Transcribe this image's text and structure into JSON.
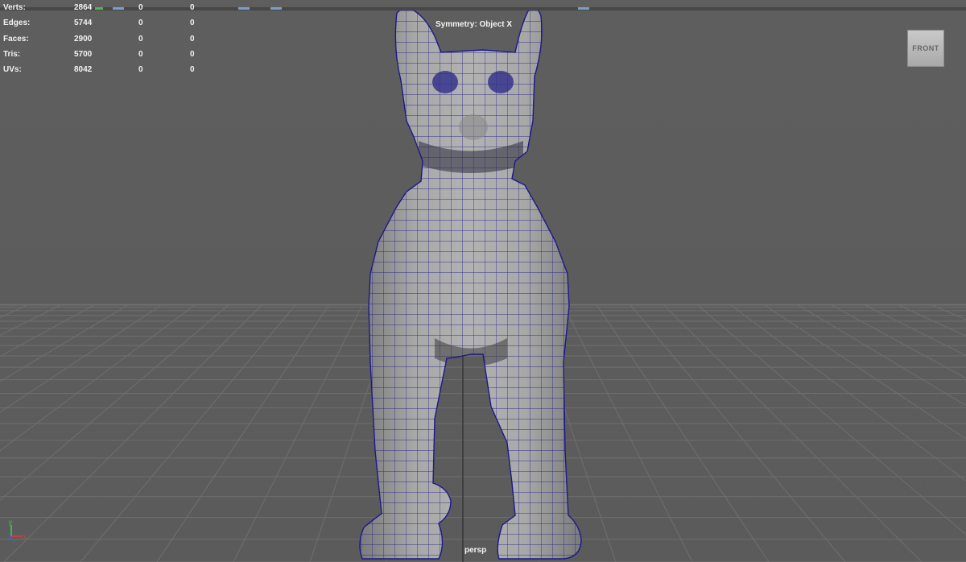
{
  "viewport": {
    "camera_name": "persp",
    "symmetry_label": "Symmetry: Object X",
    "view_cube_label": "FRONT",
    "colors": {
      "background": "#5d5d5d",
      "grid_line": "#6f6f6f",
      "grid_axis": "#3a3a3a",
      "mesh_fill": "#a4a4a4",
      "mesh_wire": "#1c1a8a",
      "hud_text": "#f2f2f2"
    }
  },
  "hud": {
    "rows": [
      {
        "label": "Verts:",
        "v1": "2864",
        "v2": "0",
        "v3": "0"
      },
      {
        "label": "Edges:",
        "v1": "5744",
        "v2": "0",
        "v3": "0"
      },
      {
        "label": "Faces:",
        "v1": "2900",
        "v2": "0",
        "v3": "0"
      },
      {
        "label": "Tris:",
        "v1": "5700",
        "v2": "0",
        "v3": "0"
      },
      {
        "label": "UVs:",
        "v1": "8042",
        "v2": "0",
        "v3": "0"
      }
    ]
  },
  "axis_indicator": {
    "axes": [
      "y",
      "x",
      "z"
    ],
    "colors": {
      "x": "#e23a3a",
      "y": "#42d14a",
      "z": "#3a63e2"
    }
  },
  "icons": [
    "top-shelf-icons",
    "dog-mesh-model",
    "view-cube",
    "axis-gizmo-icon"
  ]
}
